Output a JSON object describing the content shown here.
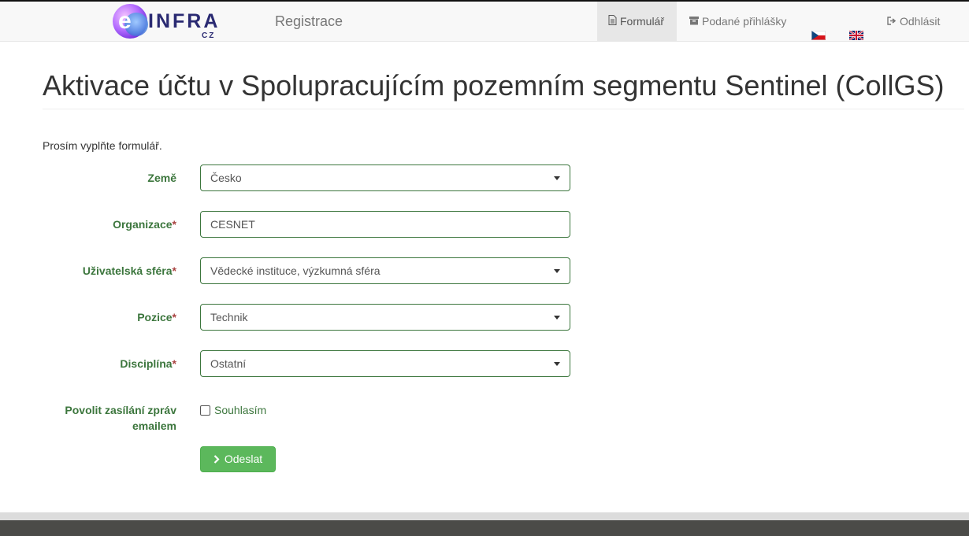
{
  "navbar": {
    "logo": {
      "wordmark": "e-INFRA",
      "subtext": "CZ"
    },
    "brand_title": "Registrace",
    "items": [
      {
        "label": "Formulář",
        "icon": "document-icon",
        "active": true
      },
      {
        "label": "Podané přihlášky",
        "icon": "archive-box-icon",
        "active": false
      },
      {
        "label": "",
        "icon": "flag-cz-icon",
        "active": false
      },
      {
        "label": "",
        "icon": "flag-uk-icon",
        "active": false
      },
      {
        "label": "Odhlásit",
        "icon": "logout-icon",
        "active": false
      }
    ]
  },
  "page": {
    "title": "Aktivace účtu v Spolupracujícím pozemním segmentu Sentinel (CollGS)",
    "intro": "Prosím vyplňte formulář."
  },
  "form": {
    "required_marker": "*",
    "fields": [
      {
        "label": "Země",
        "value": "Česko",
        "type": "select",
        "required": false
      },
      {
        "label": "Organizace",
        "value": "CESNET",
        "type": "text",
        "required": true
      },
      {
        "label": "Uživatelská sféra",
        "value": "Vědecké instituce, výzkumná sféra",
        "type": "select",
        "required": true
      },
      {
        "label": "Pozice",
        "value": "Technik",
        "type": "select",
        "required": true
      },
      {
        "label": "Disciplína",
        "value": "Ostatní",
        "type": "select",
        "required": true
      }
    ],
    "email_consent": {
      "label_line1": "Povolit zasílání zpráv",
      "label_line2": "emailem",
      "checkbox_label": "Souhlasím",
      "checked": false
    },
    "submit_label": "Odeslat"
  },
  "colors": {
    "label_green": "#3c763d",
    "required_red": "#a94442",
    "button_green": "#5cb85c",
    "navbar_bg": "#f8f8f8",
    "footer_dark": "#4b4b48"
  }
}
